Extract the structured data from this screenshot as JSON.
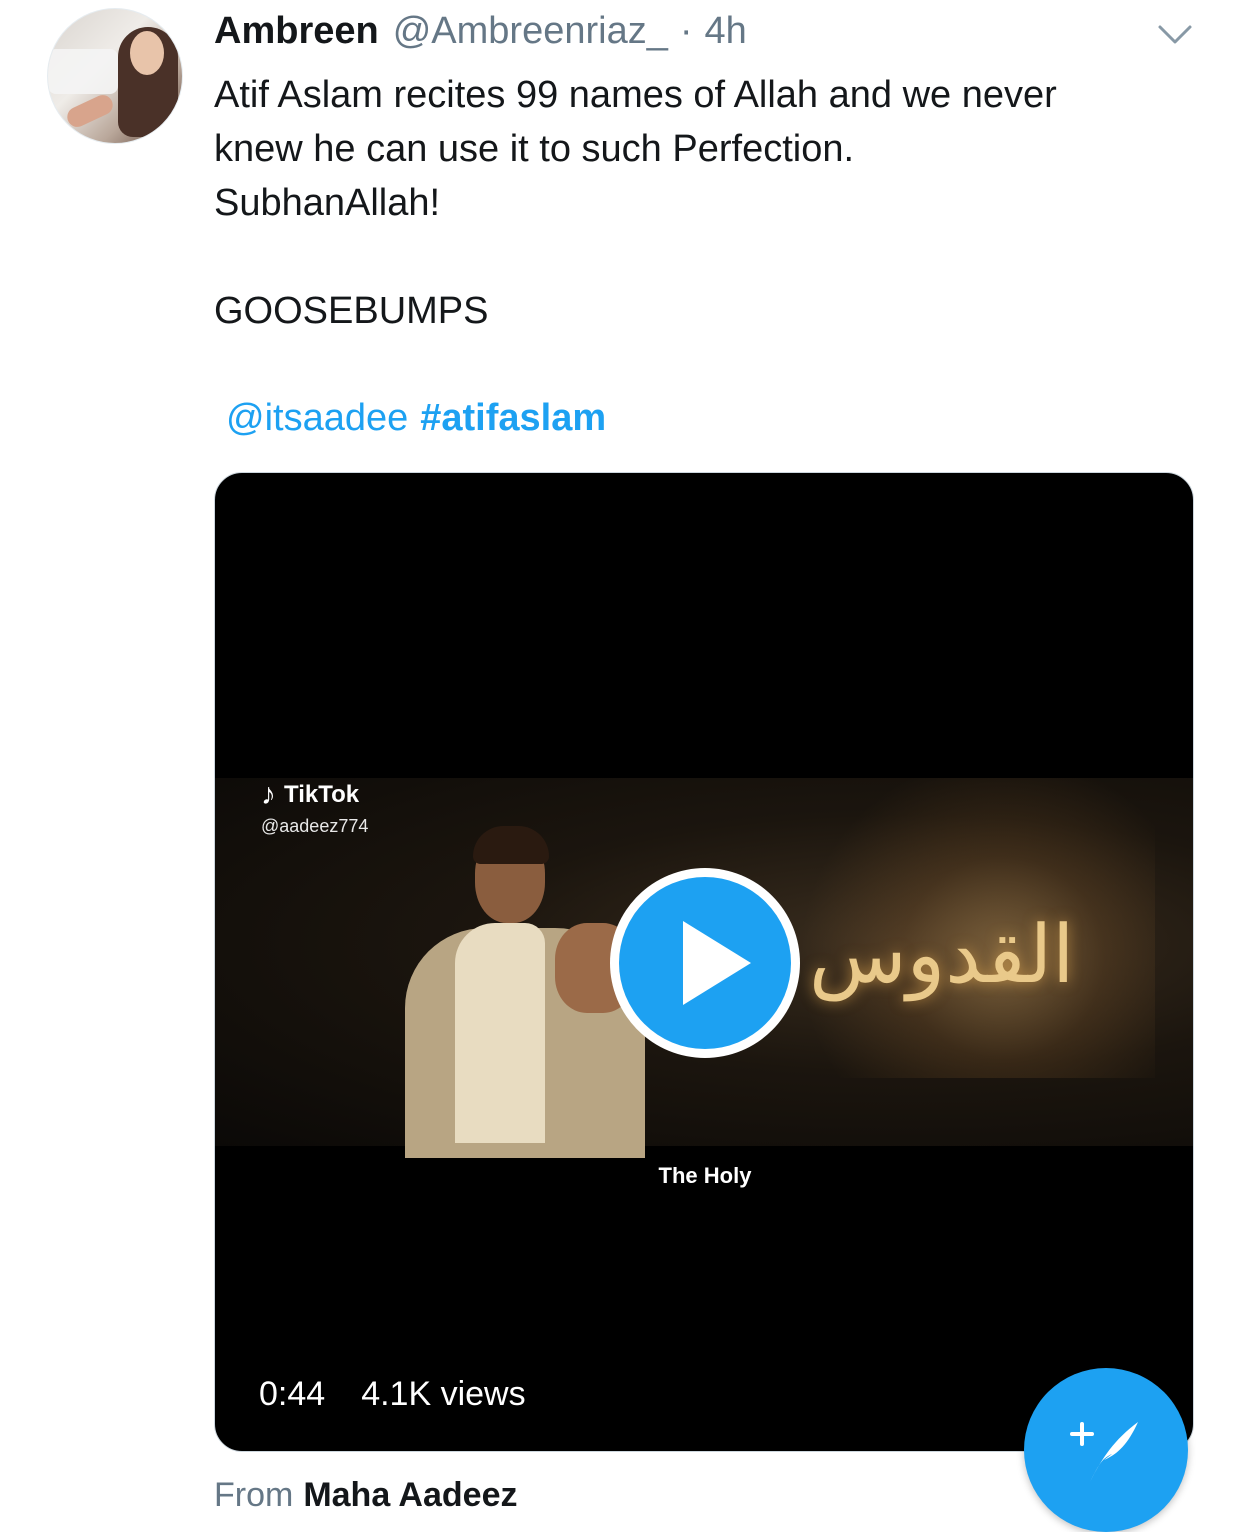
{
  "tweet": {
    "author_name": "Ambreen",
    "author_handle": "@Ambreenriaz_",
    "separator": "·",
    "time": "4h",
    "text": "Atif Aslam recites 99 names of Allah and we never\nknew he can use it to such Perfection.\nSubhanAllah!\n\nGOOSEBUMPS",
    "mention": "@itsaadee",
    "hashtag": "#atifaslam"
  },
  "video": {
    "watermark_brand": "TikTok",
    "watermark_user": "@aadeez774",
    "arabic_text": "القدوس",
    "caption": "The Holy",
    "duration": "0:44",
    "views": "4.1K views"
  },
  "source": {
    "label": "From",
    "name": "Maha Aadeez"
  },
  "colors": {
    "accent": "#1da1f2",
    "secondary_text": "#657786",
    "primary_text": "#14171a"
  },
  "icons": [
    "chevron-down-icon",
    "play-icon",
    "tiktok-note-icon",
    "compose-tweet-icon"
  ]
}
